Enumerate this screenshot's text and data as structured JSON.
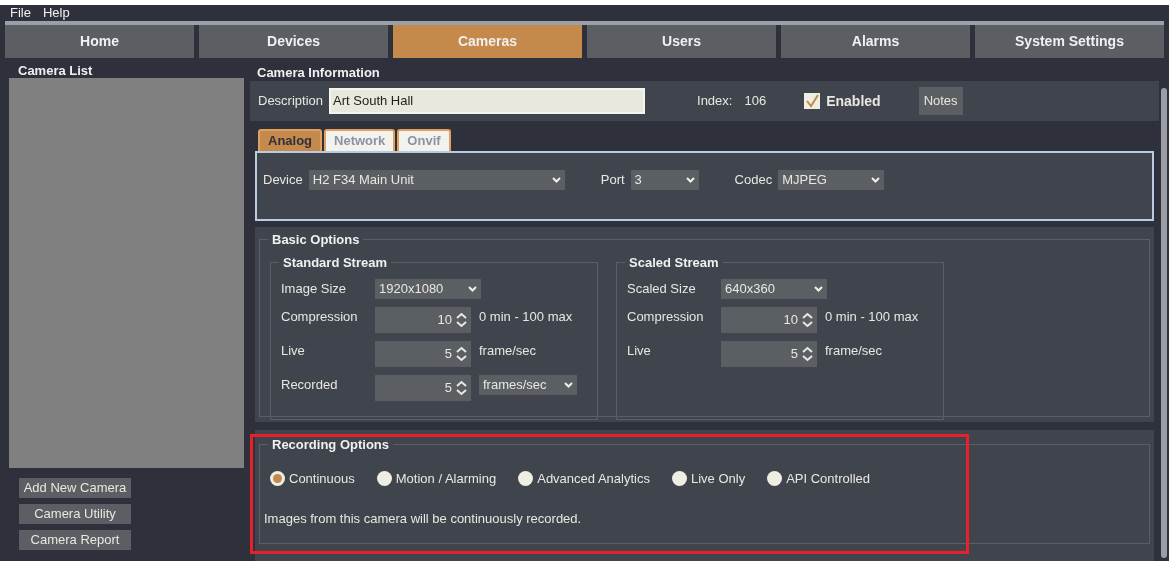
{
  "menu": [
    "File",
    "Help"
  ],
  "nav_tabs": [
    {
      "label": "Home",
      "selected": false
    },
    {
      "label": "Devices",
      "selected": false
    },
    {
      "label": "Cameras",
      "selected": true
    },
    {
      "label": "Users",
      "selected": false
    },
    {
      "label": "Alarms",
      "selected": false
    },
    {
      "label": "System Settings",
      "selected": false
    }
  ],
  "camera_list": {
    "title": "Camera List",
    "buttons": [
      "Add New Camera",
      "Camera Utility",
      "Camera Report"
    ]
  },
  "camera_information": {
    "title": "Camera Information",
    "description_label": "Description",
    "description": "Art South Hall",
    "index_label": "Index:",
    "index": "106",
    "enabled_label": "Enabled",
    "enabled": true,
    "notes": "Notes",
    "tabs": [
      {
        "label": "Analog",
        "selected": true
      },
      {
        "label": "Network",
        "selected": false
      },
      {
        "label": "Onvif",
        "selected": false
      }
    ],
    "device_label": "Device",
    "device": "H2 F34 Main Unit",
    "port_label": "Port",
    "port": "3",
    "codec_label": "Codec",
    "codec": "MJPEG"
  },
  "basic_options": {
    "title": "Basic Options",
    "streams": [
      {
        "title": "Standard Stream",
        "rows": [
          {
            "kind": "select",
            "label": "Image Size",
            "value": "1920x1080"
          },
          {
            "kind": "spin",
            "label": "Compression",
            "value": "10",
            "note": "0 min - 100 max"
          },
          {
            "kind": "spin",
            "label": "Live",
            "value": "5",
            "note": "frame/sec"
          },
          {
            "kind": "spin_select",
            "label": "Recorded",
            "value": "5",
            "unit": "frames/sec"
          }
        ]
      },
      {
        "title": "Scaled Stream",
        "rows": [
          {
            "kind": "select",
            "label": "Scaled Size",
            "value": "640x360"
          },
          {
            "kind": "spin",
            "label": "Compression",
            "value": "10",
            "note": "0 min - 100 max"
          },
          {
            "kind": "spin",
            "label": "Live",
            "value": "5",
            "note": "frame/sec"
          }
        ]
      }
    ]
  },
  "recording_options": {
    "title": "Recording Options",
    "highlighted": true,
    "modes": [
      {
        "label": "Continuous",
        "selected": true
      },
      {
        "label": "Motion / Alarming",
        "selected": false
      },
      {
        "label": "Advanced Analytics",
        "selected": false
      },
      {
        "label": "Live Only",
        "selected": false
      },
      {
        "label": "API Controlled",
        "selected": false
      }
    ],
    "description": "Images from this camera will be continuously recorded."
  }
}
